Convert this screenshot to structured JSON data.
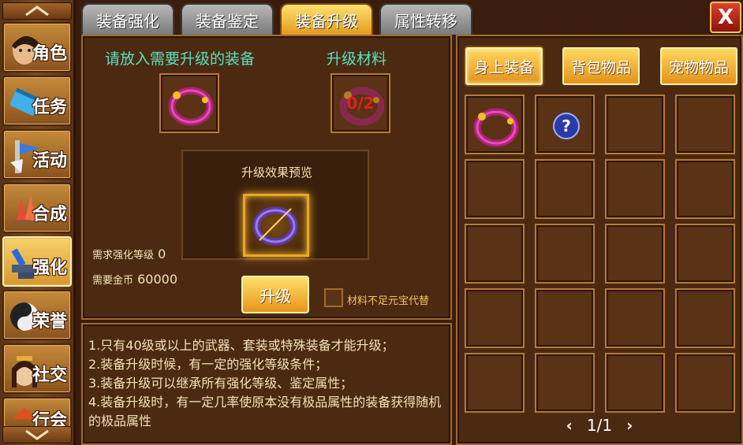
{
  "sidebar": {
    "items": [
      {
        "label": "角色",
        "icon": "character-icon",
        "active": false
      },
      {
        "label": "任务",
        "icon": "quest-scroll-icon",
        "active": false
      },
      {
        "label": "活动",
        "icon": "activity-icon",
        "active": false
      },
      {
        "label": "合成",
        "icon": "crystal-synthesis-icon",
        "active": false
      },
      {
        "label": "强化",
        "icon": "anvil-enhance-icon",
        "active": true
      },
      {
        "label": "荣誉",
        "icon": "honor-yinyang-icon",
        "active": false
      },
      {
        "label": "社交",
        "icon": "social-portrait-icon",
        "active": false
      },
      {
        "label": "行会",
        "icon": "guild-icon",
        "active": false
      }
    ]
  },
  "tabs": [
    {
      "label": "装备强化",
      "active": false
    },
    {
      "label": "装备鉴定",
      "active": false
    },
    {
      "label": "装备升级",
      "active": true
    },
    {
      "label": "属性转移",
      "active": false
    }
  ],
  "close_label": "X",
  "upgrade": {
    "equip_label": "请放入需要升级的装备",
    "material_label": "升级材料",
    "material_count": "0/2",
    "preview_title": "升级效果预览",
    "req_enhance_label": "需求强化等级",
    "req_enhance_value": "0",
    "req_gold_label": "需要金币",
    "req_gold_value": "60000",
    "upgrade_button": "升级",
    "substitute_label": "材料不足元宝代替",
    "substitute_checked": false
  },
  "info": {
    "lines": [
      "1.只有40级或以上的武器、套装或特殊装备才能升级；",
      "2.装备升级时候，有一定的强化等级条件；",
      "3.装备升级可以继承所有强化等级、鉴定属性；",
      "4.装备升级时，有一定几率使原本没有极品属性的装备获得随机的极品属性"
    ]
  },
  "inventory": {
    "tabs": [
      {
        "label": "身上装备",
        "active": true
      },
      {
        "label": "背包物品",
        "active": false
      },
      {
        "label": "宠物物品",
        "active": false
      }
    ],
    "slots": [
      "ring-icon",
      "question-mark-icon",
      "",
      "",
      "",
      "",
      "",
      "",
      "",
      "",
      "",
      "",
      "",
      "",
      "",
      "",
      "",
      "",
      "",
      ""
    ],
    "page": "1/1"
  },
  "colors": {
    "accent_gold": "#e3921a",
    "teal_label": "#58e0c0",
    "material_count_red": "#e02020"
  }
}
